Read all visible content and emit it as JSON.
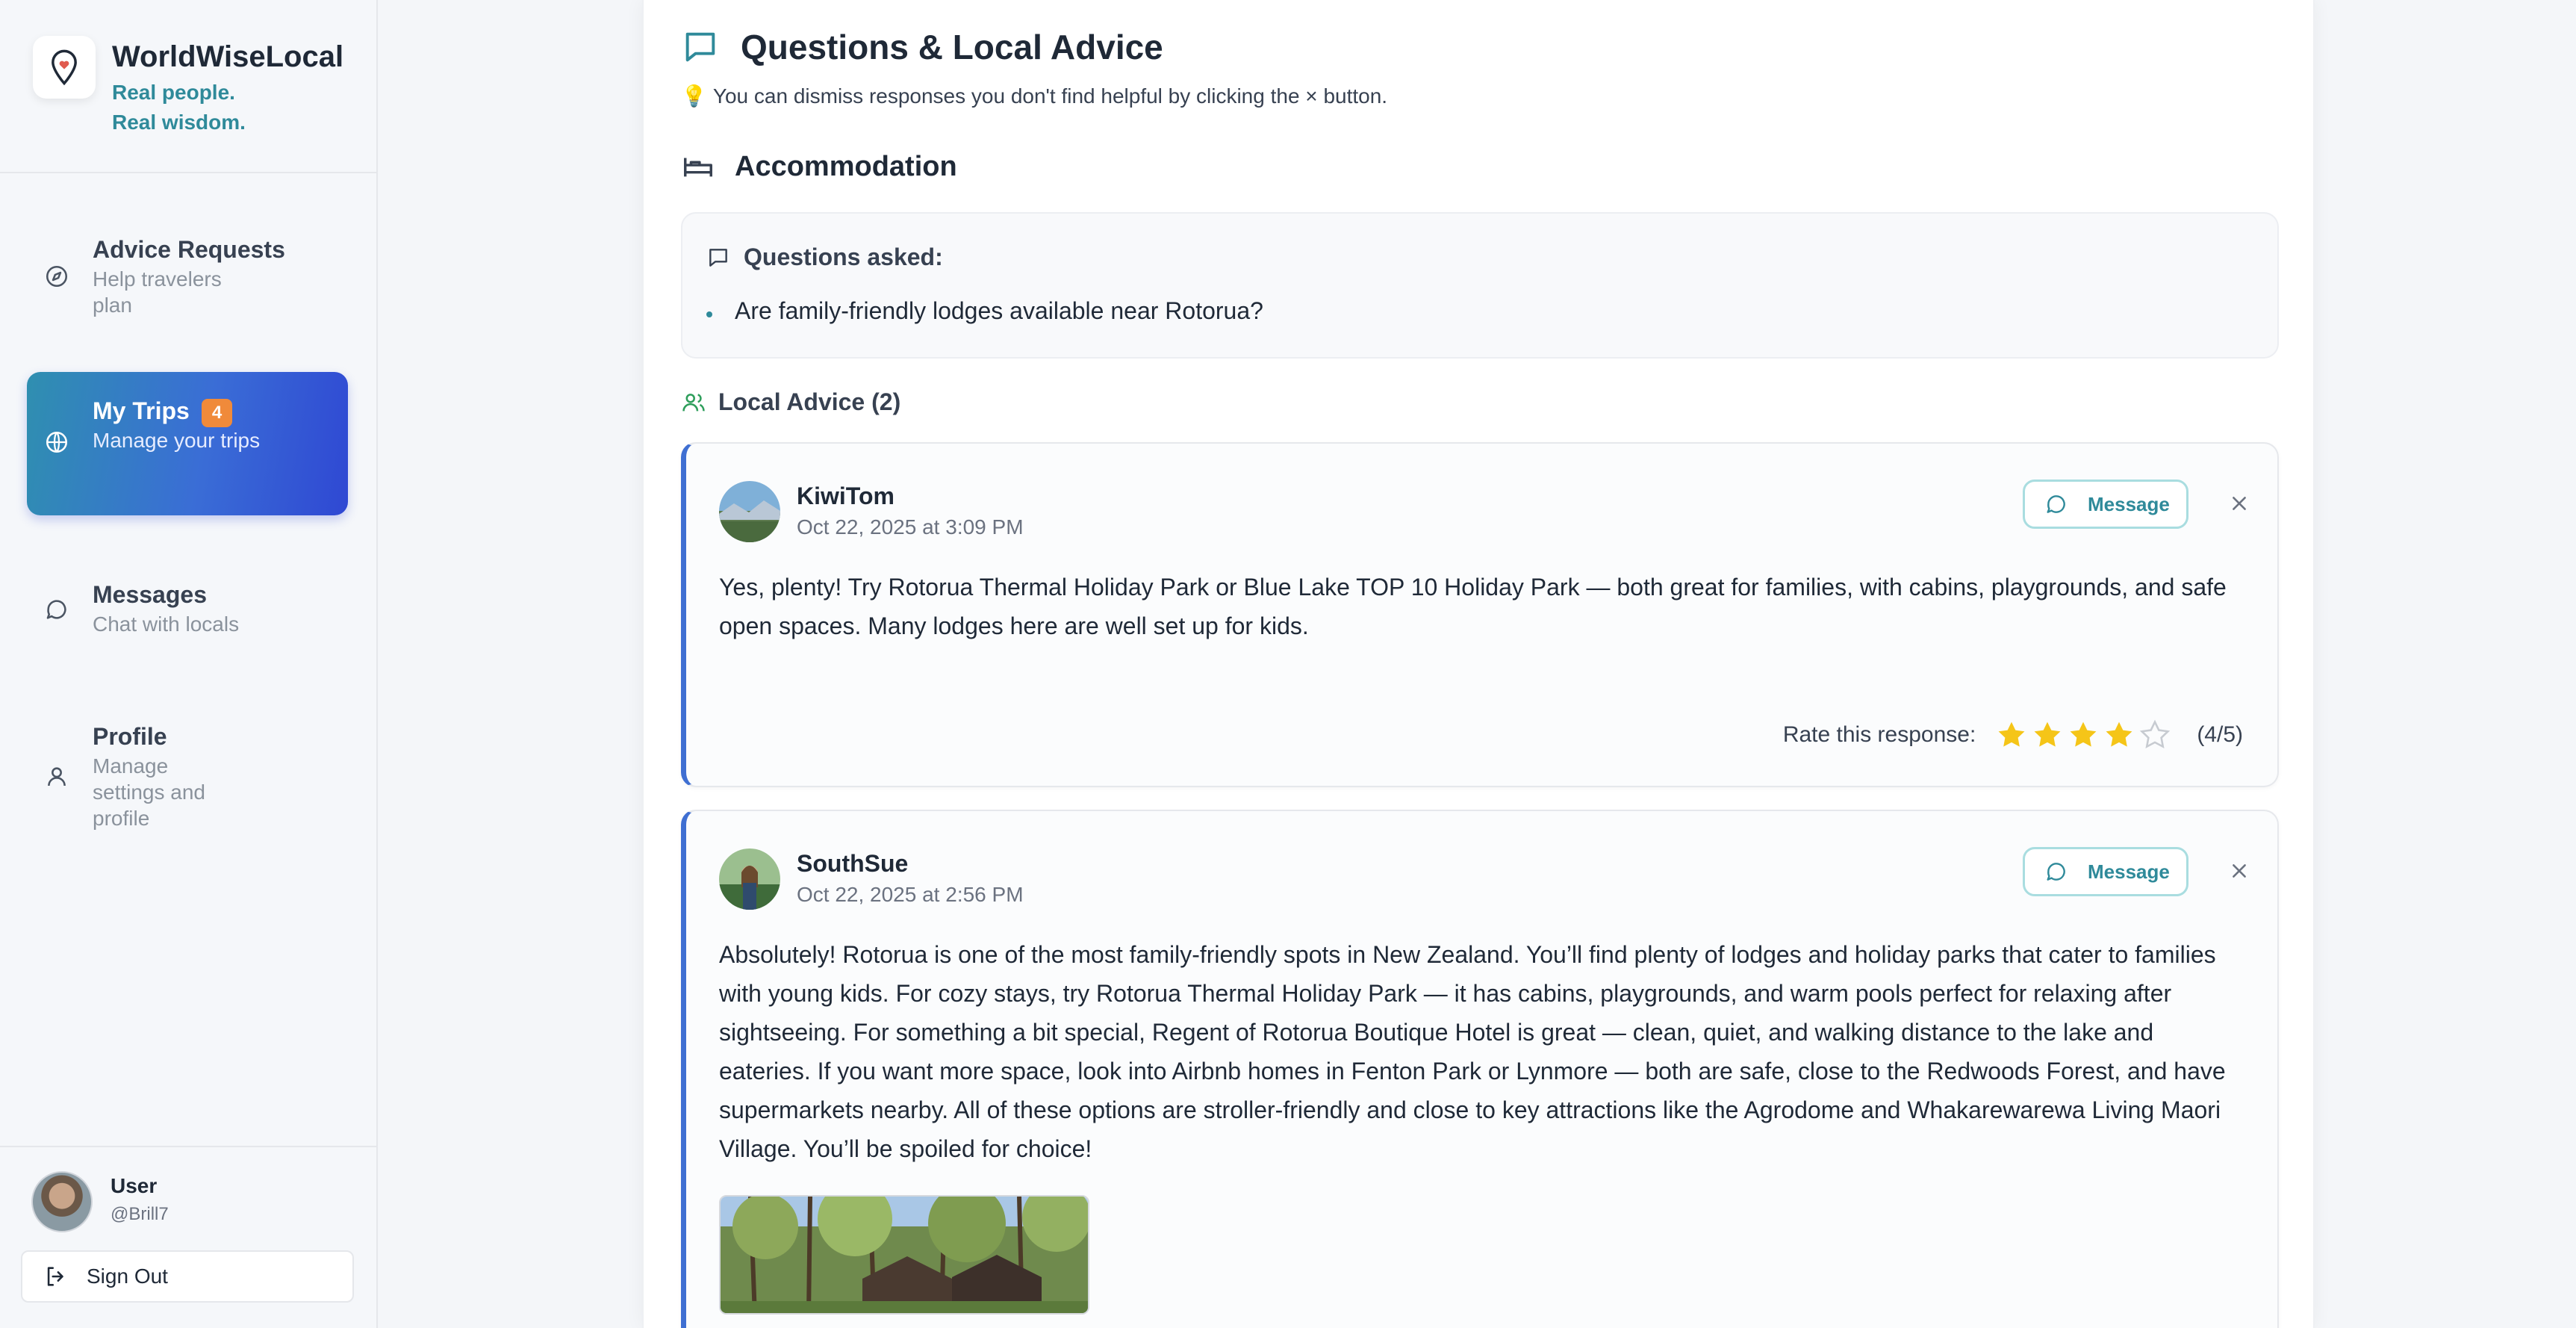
{
  "app": {
    "name": "WorldWiseLocal",
    "tagline_line1": "Real people.",
    "tagline_line2": "Real wisdom."
  },
  "sidebar": {
    "items": [
      {
        "title": "Advice Requests",
        "subtitle": "Help travelers plan",
        "icon": "compass-icon"
      },
      {
        "title": "My Trips",
        "subtitle": "Manage your trips",
        "icon": "globe-icon",
        "badge": "4",
        "active": true
      },
      {
        "title": "Messages",
        "subtitle": "Chat with locals",
        "icon": "chat-bubble-icon"
      },
      {
        "title": "Profile",
        "subtitle": "Manage settings and profile",
        "icon": "person-icon"
      }
    ],
    "user": {
      "name": "User",
      "handle": "@Brill7"
    },
    "sign_out_label": "Sign Out"
  },
  "main": {
    "section_title": "Questions & Local Advice",
    "hint": "You can dismiss responses you don't find helpful by clicking the × button.",
    "category": "Accommodation",
    "questions_heading": "Questions asked:",
    "questions": [
      "Are family-friendly lodges available near Rotorua?"
    ],
    "advice_heading": "Local Advice (2)",
    "responses": [
      {
        "author": "KiwiTom",
        "date": "Oct 22, 2025 at 3:09 PM",
        "message_label": "Message",
        "body": "Yes, plenty! Try Rotorua Thermal Holiday Park or Blue Lake TOP 10 Holiday Park — both great for families, with cabins, playgrounds, and safe open spaces. Many lodges here are well set up for kids.",
        "rating_label": "Rate this response:",
        "rating": 4,
        "rating_max": 5,
        "rating_text": "(4/5)"
      },
      {
        "author": "SouthSue",
        "date": "Oct 22, 2025 at 2:56 PM",
        "message_label": "Message",
        "body": "Absolutely! Rotorua is one of the most family-friendly spots in New Zealand. You’ll find plenty of lodges and holiday parks that cater to families with young kids. For cozy stays, try Rotorua Thermal Holiday Park — it has cabins, playgrounds, and warm pools perfect for relaxing after sightseeing. For something a bit special, Regent of Rotorua Boutique Hotel is great — clean, quiet, and walking distance to the lake and eateries. If you want more space, look into Airbnb homes in Fenton Park or Lynmore — both are safe, close to the Redwoods Forest, and have supermarkets nearby. All of these options are stroller-friendly and close to key attractions like the Agrodome and Whakarewarewa Living Maori Village. You’ll be spoiled for choice!"
      }
    ]
  },
  "colors": {
    "accent_teal": "#2f8a9a",
    "active_gradient_start": "#2f8fb0",
    "active_gradient_end": "#2f48d3",
    "badge": "#f08a3a",
    "card_border_left": "#3f6fd2",
    "star_filled": "#f5c518"
  }
}
